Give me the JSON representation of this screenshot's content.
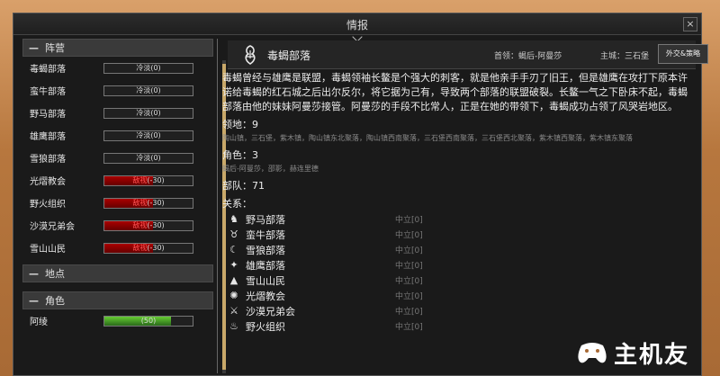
{
  "window": {
    "title": "情报"
  },
  "left": {
    "factions_header": "阵营",
    "factions": [
      {
        "name": "毒蝎部落",
        "bar_text": "冷淡(0)",
        "kind": "neutral",
        "level": 0.0
      },
      {
        "name": "蛮牛部落",
        "bar_text": "冷淡(0)",
        "kind": "neutral",
        "level": 0.0
      },
      {
        "name": "野马部落",
        "bar_text": "冷淡(0)",
        "kind": "neutral",
        "level": 0.0
      },
      {
        "name": "雄鹰部落",
        "bar_text": "冷淡(0)",
        "kind": "neutral",
        "level": 0.0
      },
      {
        "name": "雪狼部落",
        "bar_text": "冷淡(0)",
        "kind": "neutral",
        "level": 0.0
      },
      {
        "name": "光熠教会",
        "bar_prefix": "敌视",
        "bar_value": "(-30)",
        "kind": "hostile",
        "level": 0.55
      },
      {
        "name": "野火组织",
        "bar_prefix": "敌视",
        "bar_value": "(-30)",
        "kind": "hostile",
        "level": 0.55
      },
      {
        "name": "沙漠兄弟会",
        "bar_prefix": "敌视",
        "bar_value": "(-30)",
        "kind": "hostile",
        "level": 0.55
      },
      {
        "name": "雪山山民",
        "bar_prefix": "敌视",
        "bar_value": "(-30)",
        "kind": "hostile",
        "level": 0.55
      }
    ],
    "places_header": "地点",
    "characters_header": "角色",
    "characters": [
      {
        "name": "阿绫",
        "bar_text": "(50)",
        "kind": "friendly",
        "level": 0.75
      }
    ]
  },
  "detail": {
    "name": "毒蝎部落",
    "leader": "首领：蝎后-阿曼莎",
    "main_city": "主城：三石堡",
    "diplomacy_button": "外交&策略",
    "description": "毒蝎曾经与雄鹰是联盟，毒蝎领袖长鳌是个强大的刺客，就是他亲手手刃了旧王，但是雄鹰在攻打下原本许诺给毒蝎的红石城之后出尔反尔，将它据为己有，导致两个部落的联盟破裂。长鳌一气之下卧床不起，毒蝎部落由他的妹妹阿曼莎接管。阿曼莎的手段不比常人，正是在她的带领下，毒蝎成功占领了风哭岩地区。",
    "territory_label": "领地：9",
    "territory_list": "陶山镇，三石堡，紫木镇，陶山镇东北聚落，陶山镇西南聚落，三石堡西南聚落，三石堡西北聚落，紫木镇西聚落，紫木镇东聚落",
    "roles_label": "角色：3",
    "roles_list": "蝎后-阿曼莎，邵影，赫连里德",
    "troops_label": "部队：71",
    "relations_label": "关系：",
    "relations": [
      {
        "icon": "horse-icon",
        "glyph": "♞",
        "name": "野马部落",
        "status": "中立[0]"
      },
      {
        "icon": "bull-icon",
        "glyph": "♉",
        "name": "蛮牛部落",
        "status": "中立[0]"
      },
      {
        "icon": "wolf-icon",
        "glyph": "☾",
        "name": "雪狼部落",
        "status": "中立[0]"
      },
      {
        "icon": "eagle-icon",
        "glyph": "✦",
        "name": "雄鹰部落",
        "status": "中立[0]"
      },
      {
        "icon": "mountain-icon",
        "glyph": "▲",
        "name": "雪山山民",
        "status": "中立[0]"
      },
      {
        "icon": "sun-icon",
        "glyph": "✺",
        "name": "光熠教会",
        "status": "中立[0]"
      },
      {
        "icon": "swords-icon",
        "glyph": "⚔",
        "name": "沙漠兄弟会",
        "status": "中立[0]"
      },
      {
        "icon": "flame-icon",
        "glyph": "♨",
        "name": "野火组织",
        "status": "中立[0]"
      }
    ]
  },
  "watermark": {
    "text": "主机友"
  }
}
